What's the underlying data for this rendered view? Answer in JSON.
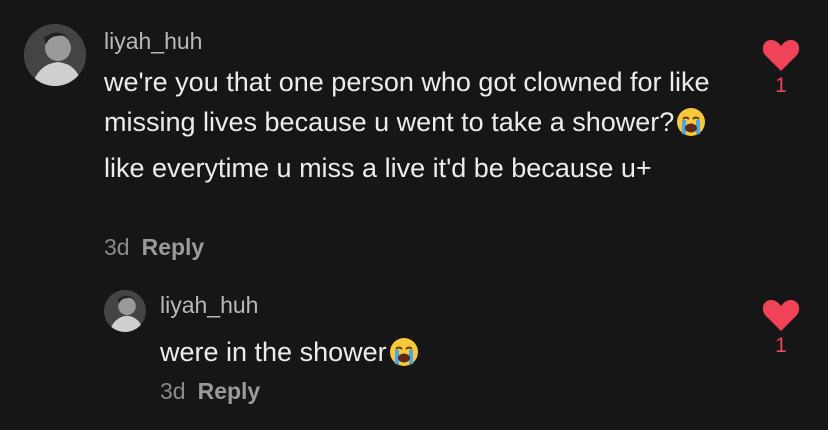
{
  "comments": [
    {
      "username": "liyah_huh",
      "text_parts": [
        "we're you that one person who got clowned for like missing lives because u went to take a shower?",
        " like everytime u miss a live it'd be because u+"
      ],
      "emoji": "loudly-crying-face-icon",
      "time": "3d",
      "reply_label": "Reply",
      "like_count": "1"
    },
    {
      "username": "liyah_huh",
      "text_parts": [
        "were in the shower"
      ],
      "emoji": "loudly-crying-face-icon",
      "time": "3d",
      "reply_label": "Reply",
      "like_count": "1"
    }
  ],
  "colors": {
    "background": "#161616",
    "like_accent": "#f0435a"
  }
}
